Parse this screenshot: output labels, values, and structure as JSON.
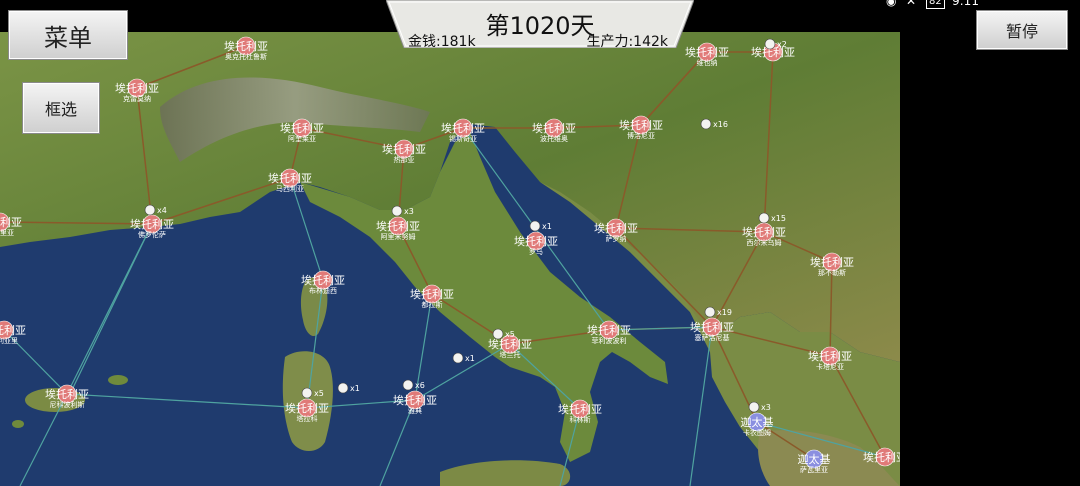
{
  "ui": {
    "menu_label": "菜单",
    "select_label": "框选",
    "pause_label": "暂停",
    "day_label": "第1020天",
    "money_label": "金钱:181k",
    "production_label": "生产力:142k"
  },
  "status_bar": {
    "time": "9:11",
    "battery": "82"
  },
  "colors": {
    "own_city": "#e07a78",
    "enemy_city": "#8a8fe0",
    "road": "#8a5a2a",
    "sea_route": "#4fa3a0",
    "sea": "#1f3b6e",
    "land": "#6f8a3c"
  },
  "cities": [
    {
      "id": "c1",
      "owner": "own",
      "name": "埃托利亚",
      "sub": "奥克托杜鲁斯"
    },
    {
      "id": "c2",
      "owner": "own",
      "name": "埃托利亚",
      "sub": "维也纳"
    },
    {
      "id": "c3",
      "owner": "own",
      "name": "埃托利亚",
      "sub": "克雷莫纳"
    },
    {
      "id": "c4",
      "owner": "own",
      "name": "埃托利亚",
      "sub": "阿奎莱亚"
    },
    {
      "id": "c5",
      "owner": "own",
      "name": "埃托利亚",
      "sub": "锡斯奇亚"
    },
    {
      "id": "c6",
      "owner": "own",
      "name": "埃托利亚",
      "sub": "波托维奥"
    },
    {
      "id": "c7",
      "owner": "own",
      "name": "埃托利亚",
      "sub": "博洛尼亚"
    },
    {
      "id": "c8",
      "owner": "own",
      "name": "埃托利亚",
      "sub": "热那亚"
    },
    {
      "id": "c9",
      "owner": "own",
      "name": "埃托利亚",
      "sub": "马西利亚"
    },
    {
      "id": "c10",
      "owner": "own",
      "name": "埃托利亚",
      "sub": "佛罗伦萨"
    },
    {
      "id": "c11",
      "owner": "own",
      "name": "埃托利亚",
      "sub": "阿里米努姆"
    },
    {
      "id": "c12",
      "owner": "own",
      "name": "埃托利亚",
      "sub": "萨罗纳"
    },
    {
      "id": "c13",
      "owner": "own",
      "name": "埃托利亚",
      "sub": "西尔米乌姆"
    },
    {
      "id": "c14",
      "owner": "own",
      "name": "埃托利亚",
      "sub": "阿莱里亚"
    },
    {
      "id": "c15",
      "owner": "own",
      "name": "埃托利亚",
      "sub": "罗马"
    },
    {
      "id": "c16",
      "owner": "own",
      "name": "埃托利亚",
      "sub": "那不勒斯"
    },
    {
      "id": "c17",
      "owner": "own",
      "name": "埃托利亚",
      "sub": "布林迪西"
    },
    {
      "id": "c18",
      "owner": "own",
      "name": "埃托利亚",
      "sub": "都拉斯"
    },
    {
      "id": "c19",
      "owner": "own",
      "name": "埃托利亚",
      "sub": "菲利波波利"
    },
    {
      "id": "c20",
      "owner": "own",
      "name": "埃托利亚",
      "sub": "塞萨洛尼基"
    },
    {
      "id": "c21",
      "owner": "own",
      "name": "埃托利亚",
      "sub": "塔兰托"
    },
    {
      "id": "c22",
      "owner": "own",
      "name": "埃托利亚",
      "sub": "卡利亚里"
    },
    {
      "id": "c23",
      "owner": "own",
      "name": "埃托利亚",
      "sub": "卡塔尼亚"
    },
    {
      "id": "c24",
      "owner": "own",
      "name": "埃托利亚",
      "sub": "尼科波利斯"
    },
    {
      "id": "c25",
      "owner": "own",
      "name": "埃托利亚",
      "sub": "塔拉科"
    },
    {
      "id": "c26",
      "owner": "own",
      "name": "埃托利亚",
      "sub": "雅典"
    },
    {
      "id": "c27",
      "owner": "own",
      "name": "埃托利亚",
      "sub": "科林斯"
    },
    {
      "id": "c28",
      "owner": "enemy",
      "name": "迦太基",
      "sub": "卡农图姆"
    },
    {
      "id": "c29",
      "owner": "enemy",
      "name": "迦太基",
      "sub": "萨瓦里亚"
    },
    {
      "id": "c30",
      "owner": "own",
      "name": "埃托利亚",
      "sub": ""
    },
    {
      "id": "c31",
      "owner": "own",
      "name": "埃托利亚",
      "sub": ""
    }
  ],
  "armies": [
    {
      "id": "a1",
      "count": "x4"
    },
    {
      "id": "a2",
      "count": "x3"
    },
    {
      "id": "a3",
      "count": "x16"
    },
    {
      "id": "a4",
      "count": "x15"
    },
    {
      "id": "a5",
      "count": "x1"
    },
    {
      "id": "a6",
      "count": "x19"
    },
    {
      "id": "a7",
      "count": "x5"
    },
    {
      "id": "a8",
      "count": "x5"
    },
    {
      "id": "a9",
      "count": "x1"
    },
    {
      "id": "a10",
      "count": "x6"
    },
    {
      "id": "a11",
      "count": "x1"
    },
    {
      "id": "a12",
      "count": "x3"
    },
    {
      "id": "a13",
      "count": "x2"
    }
  ]
}
